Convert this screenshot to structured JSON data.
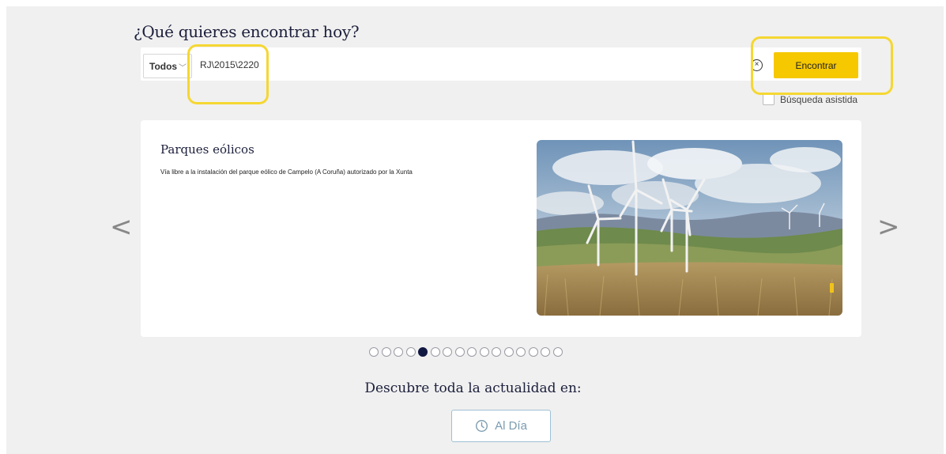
{
  "search": {
    "title": "¿Qué quieres encontrar hoy?",
    "scope_select": "Todos",
    "query_value": "RJ\\2015\\2220",
    "find_button": "Encontrar",
    "assisted_label": "Búsqueda asistida",
    "assisted_checked": false
  },
  "carousel": {
    "title": "Parques eólicos",
    "description": "Vía libre a la instalación del parque eólico de Campelo (A Coruña) autorizado por la Xunta",
    "slide_count": 16,
    "active_index": 4
  },
  "footer": {
    "heading": "Descubre toda la actualidad en:",
    "button_label": "Al Día"
  },
  "colors": {
    "accent": "#f6c800",
    "highlight": "#f5d732",
    "navy": "#111842"
  }
}
